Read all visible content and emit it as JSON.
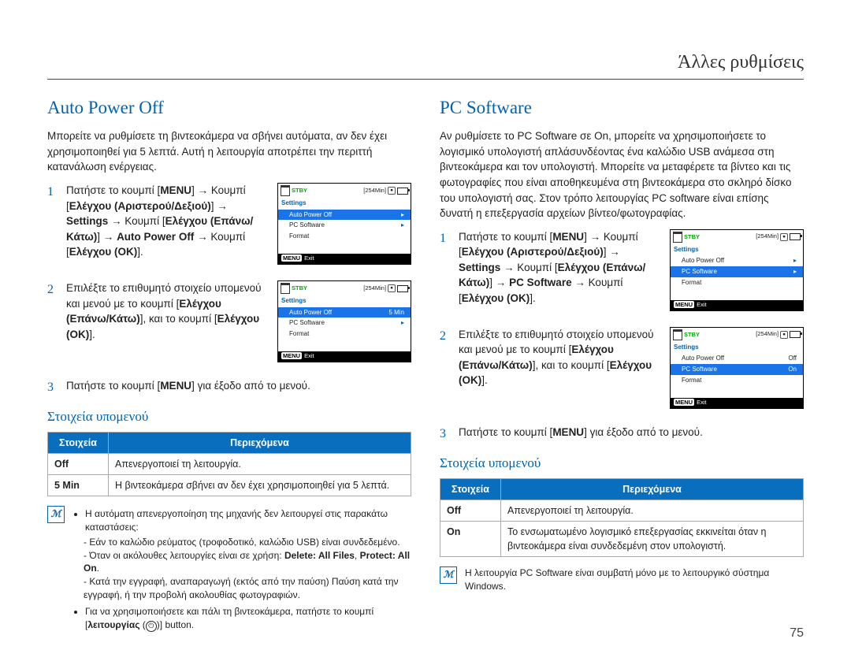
{
  "header": {
    "title": "Άλλες ρυθμίσεις"
  },
  "page_number": "75",
  "left": {
    "heading": "Auto Power Off",
    "intro": "Μπορείτε να ρυθμίσετε τη βιντεοκάμερα να σβήνει αυτόματα, αν δεν έχει χρησιμοποιηθεί για 5 λεπτά. Αυτή η λειτουργία αποτρέπει την περιττή κατανάλωση ενέργειας.",
    "steps": {
      "s1_press": "Πατήστε το κουμπί [",
      "menu_label": "MENU",
      "s1_btn2": "] → Κουμπί [",
      "ctrl_lr": "Ελέγχου (Αριστερού/Δεξιού)",
      "settings_arrow": "] → ",
      "settings_label": "Settings",
      "btn_arrow": " → Κουμπί [",
      "ctrl_ud": "Ελέγχου (Επάνω/Κάτω)",
      "apo_arrow": "] → ",
      "apo_bold": "Auto Power Off",
      "btn_ok_arrow": " → Κουμπί [",
      "ctrl_ok": "Ελέγχου (OK)",
      "close": "].",
      "s2": "Επιλέξτε το επιθυμητό στοιχείο υπομενού και μενού με το κουμπί [",
      "s2_mid": "], και το κουμπί [",
      "s3_a": "Πατήστε το κουμπί [",
      "s3_b": "] για έξοδο από το μενού."
    },
    "sub_heading": "Στοιχεία υπομενού",
    "table": {
      "h1": "Στοιχεία",
      "h2": "Περιεχόμενα",
      "r1_k": "Off",
      "r1_v": "Απενεργοποιεί τη λειτουργία.",
      "r2_k": "5 Min",
      "r2_v": "Η βιντεοκάμερα σβήνει αν δεν έχει χρησιμοποιηθεί για 5 λεπτά."
    },
    "note": {
      "b1": "Η αυτόματη απενεργοποίηση της μηχανής δεν λειτουργεί στις παρακάτω καταστάσεις:",
      "d1": "Εάν το καλώδιο ρεύματος (τροφοδοτικό, καλώδιο USB) είναι συνδεδεμένο.",
      "d2_a": "Όταν οι ακόλουθες λειτουργίες είναι σε χρήση: ",
      "d2_b": "Delete: All Files",
      "d2_c": ", ",
      "d2_d": "Protect: All On",
      "d2_e": ".",
      "d3": "Κατά την εγγραφή, αναπαραγωγή (εκτός από την παύση) Παύση κατά την εγγραφή, ή την προβολή ακολουθίας φωτογραφιών.",
      "b2_a": "Για να χρησιμοποιήσετε και πάλι τη βιντεοκάμερα, πατήστε το κουμπί [",
      "b2_b": "λειτουργίας",
      "b2_c": " (",
      "b2_d": ")] button."
    }
  },
  "right": {
    "heading": "PC Software",
    "intro": "Αν ρυθμίσετε το PC Software σε On, μπορείτε να χρησιμοποιήσετε το λογισμικό υπολογιστή απλάσυνδέοντας ένα καλώδιο USB ανάμεσα στη βιντεοκάμερα και τον υπολογιστή. Μπορείτε να μεταφέρετε τα βίντεο και τις φωτογραφίες που είναι αποθηκευμένα στη βιντεοκάμερα στο σκληρό δίσκο του υπολογιστή σας. Στον τρόπο λειτουργίας PC software είναι επίσης δυνατή η επεξεργασία αρχείων βίντεο/φωτογραφίας.",
    "steps": {
      "pcs_bold": "PC Software"
    },
    "sub_heading": "Στοιχεία υπομενού",
    "table": {
      "h1": "Στοιχεία",
      "h2": "Περιεχόμενα",
      "r1_k": "Off",
      "r1_v": "Απενεργοποιεί τη λειτουργία.",
      "r2_k": "On",
      "r2_v": "Το ενσωματωμένο λογισμικό επεξεργασίας εκκινείται όταν η βιντεοκάμερα είναι συνδεδεμένη στον υπολογιστή."
    },
    "note": "Η λειτουργία PC Software είναι συμβατή μόνο με το λειτουργικό σύστημα Windows."
  },
  "device": {
    "stby": "STBY",
    "time": "[254Min]",
    "settings": "Settings",
    "items": {
      "apo": "Auto Power Off",
      "pcs": "PC Software",
      "fmt": "Format"
    },
    "value_5min": "5 Min",
    "value_off": "Off",
    "value_on": "On",
    "menu": "MENU",
    "exit": "Exit"
  }
}
